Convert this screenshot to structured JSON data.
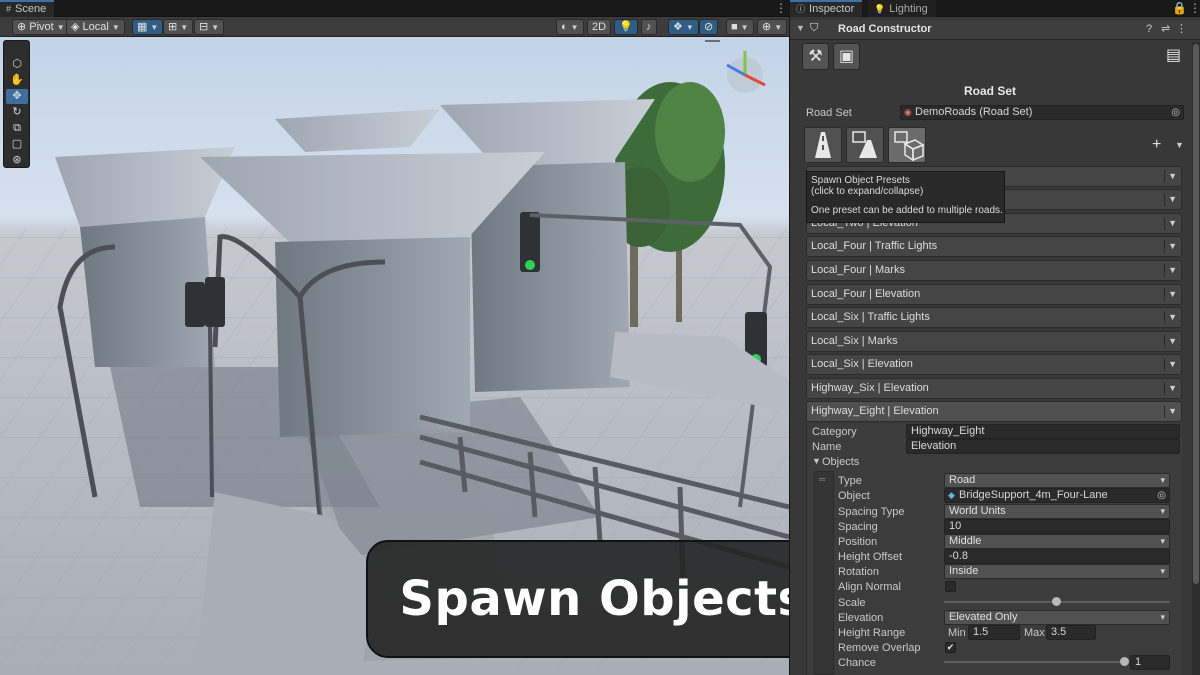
{
  "scene": {
    "tab_label": "Scene",
    "toolbar": {
      "pivot_label": "Pivot",
      "local_label": "Local",
      "mode_2d_label": "2D"
    },
    "overlay_title": "Spawn Objects"
  },
  "inspector": {
    "tabs": [
      {
        "label": "Inspector"
      },
      {
        "label": "Lighting"
      }
    ],
    "component_title": "Road Constructor",
    "section_title": "Road Set",
    "road_set_label": "Road Set",
    "road_set_value": "DemoRoads (Road Set)",
    "add_button_label": "+",
    "tooltip": {
      "line1": "Spawn Object Presets",
      "line2": "(click to expand/collapse)",
      "line3": "One preset can be added to multiple roads."
    },
    "preset_rows": [
      {
        "label": ""
      },
      {
        "label": ""
      },
      {
        "label": "Local_Two | Elevation"
      },
      {
        "label": "Local_Four | Traffic Lights"
      },
      {
        "label": "Local_Four | Marks"
      },
      {
        "label": "Local_Four | Elevation"
      },
      {
        "label": "Local_Six | Traffic Lights"
      },
      {
        "label": "Local_Six | Marks"
      },
      {
        "label": "Local_Six | Elevation"
      },
      {
        "label": "Highway_Six | Elevation"
      },
      {
        "label": "Highway_Eight | Elevation"
      }
    ],
    "expanded": {
      "category_label": "Category",
      "category_value": "Highway_Eight",
      "name_label": "Name",
      "name_value": "Elevation",
      "objects_label": "Objects",
      "type_label": "Type",
      "type_value": "Road",
      "object_label": "Object",
      "object_value": "BridgeSupport_4m_Four-Lane",
      "spacing_type_label": "Spacing Type",
      "spacing_type_value": "World Units",
      "spacing_label": "Spacing",
      "spacing_value": "10",
      "position_label": "Position",
      "position_value": "Middle",
      "height_offset_label": "Height Offset",
      "height_offset_value": "-0.8",
      "rotation_label": "Rotation",
      "rotation_value": "Inside",
      "align_normal_label": "Align Normal",
      "scale_label": "Scale",
      "elevation_label": "Elevation",
      "elevation_value": "Elevated Only",
      "height_range_label": "Height Range",
      "min_label": "Min",
      "min_value": "1.5",
      "max_label": "Max",
      "max_value": "3.5",
      "remove_overlap_label": "Remove Overlap",
      "remove_overlap_check": "✔",
      "chance_label": "Chance",
      "chance_value": "1"
    }
  },
  "colors": {
    "accent_blue": "#3a72b0",
    "panel_bg": "#383838",
    "scene_sky": "#c3d3e8"
  }
}
